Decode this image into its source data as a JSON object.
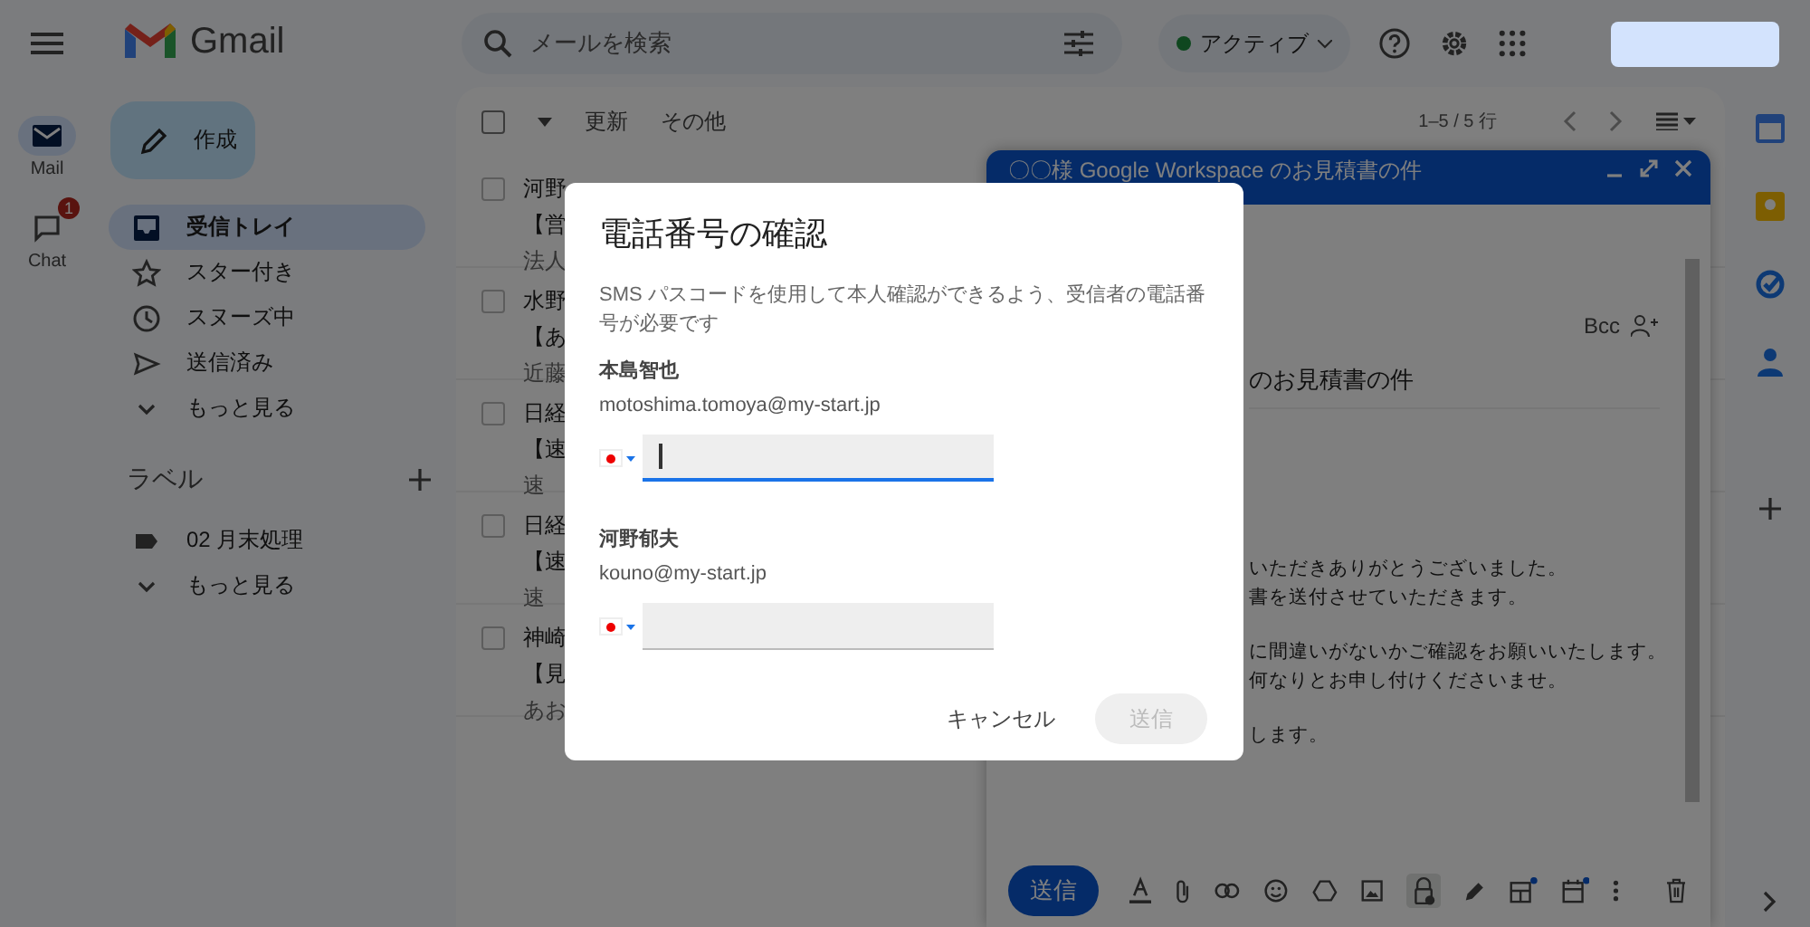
{
  "rail": [
    {
      "label": "Mail",
      "selected": true,
      "kind": "mail"
    },
    {
      "label": "Chat",
      "selected": false,
      "kind": "chat",
      "badge": "1"
    }
  ],
  "brand": "Gmail",
  "compose_button": "作成",
  "nav": [
    {
      "label": "受信トレイ",
      "selected": true,
      "kind": "inbox"
    },
    {
      "label": "スター付き",
      "selected": false,
      "kind": "star"
    },
    {
      "label": "スヌーズ中",
      "selected": false,
      "kind": "clock"
    },
    {
      "label": "送信済み",
      "selected": false,
      "kind": "send"
    },
    {
      "label": "もっと見る",
      "selected": false,
      "kind": "more"
    }
  ],
  "labels": {
    "title": "ラベル",
    "items": [
      {
        "label": "02 月末処理",
        "kind": "label"
      },
      {
        "label": "もっと見る",
        "kind": "more"
      }
    ]
  },
  "search": {
    "placeholder": "メールを検索"
  },
  "status": "アクティブ",
  "list_toolbar": {
    "select_all": {
      "checked": false
    },
    "refresh": "更新",
    "more": "その他",
    "range": "1–5 / 5 行"
  },
  "emails": [
    {
      "sender": "河野",
      "subject": "【営",
      "snippet": "法人",
      "checked": false
    },
    {
      "sender": "水野",
      "subject": "【あ",
      "snippet": "近藤",
      "checked": false
    },
    {
      "sender": "日経",
      "subject": "【速",
      "snippet": "速",
      "checked": false
    },
    {
      "sender": "日経",
      "subject": "【速",
      "snippet": "速",
      "checked": false
    },
    {
      "sender": "神崎",
      "subject": "【見",
      "snippet": "あお",
      "checked": false
    }
  ],
  "compose": {
    "title": "〇〇様 Google Workspace のお見積書の件",
    "bcc": "Bcc",
    "subject": "のお見積書の件",
    "body": [
      [
        "いただきありがとうございました。",
        "書を送付させていただきます。"
      ],
      [
        "に間違いがないかご確認をお願いいたします。",
        "何なりとお申し付けくださいませ。"
      ],
      [
        "します。"
      ]
    ],
    "send": "送信"
  },
  "dialog": {
    "title": "電話番号の確認",
    "description": "SMS パスコードを使用して本人確認ができるよう、受信者の電話番号が必要です",
    "recipients": [
      {
        "name": "本島智也",
        "email": "motoshima.tomoya@my-start.jp",
        "focused": true
      },
      {
        "name": "河野郁夫",
        "email": "kouno@my-start.jp",
        "focused": false
      }
    ],
    "buttons": [
      {
        "label": "キャンセル",
        "disabled": false
      },
      {
        "label": "送信",
        "disabled": true
      }
    ]
  }
}
